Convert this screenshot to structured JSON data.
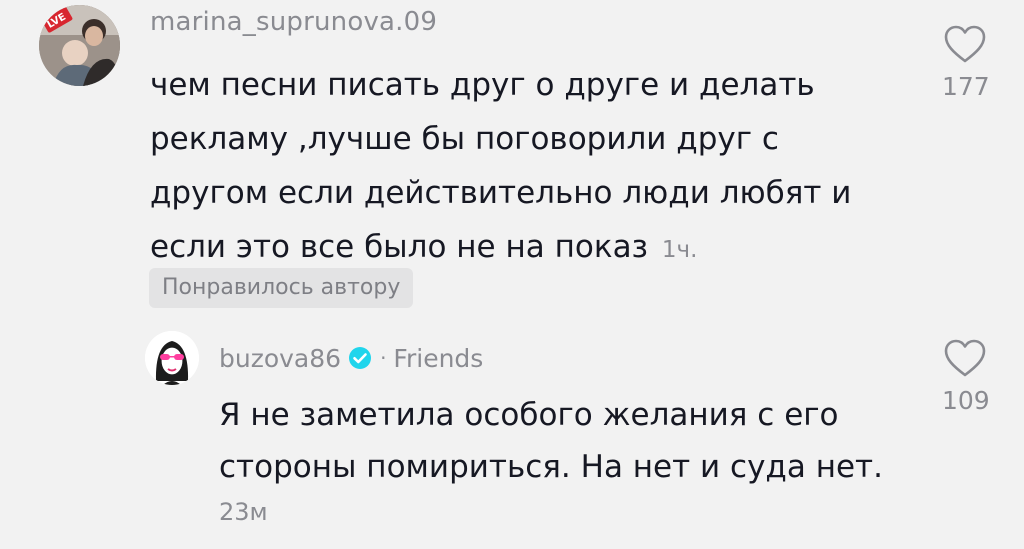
{
  "comment": {
    "username": "marina_suprunova.09",
    "text": "чем песни писать друг о друге и делать рекламу ,лучше бы поговорили друг с другом если действительно люди любят и если это все было не на показ",
    "time": "1ч.",
    "liked_by_author_label": "Понравилось автору",
    "like_count": "177",
    "like_icon": "heart-outline-icon"
  },
  "reply": {
    "username": "buzova86",
    "verified_icon": "verified-badge-icon",
    "verified_color": "#20d5ec",
    "separator": "·",
    "relation_label": "Friends",
    "text": "Я не заметила особого желания с его стороны помириться. На нет и суда нет.",
    "time": "23м",
    "like_count": "109",
    "like_icon": "heart-outline-icon"
  },
  "colors": {
    "background": "#f2f2f2",
    "primary_text": "#161823",
    "secondary_text": "#8a8b91",
    "badge_background": "#e3e3e4"
  }
}
